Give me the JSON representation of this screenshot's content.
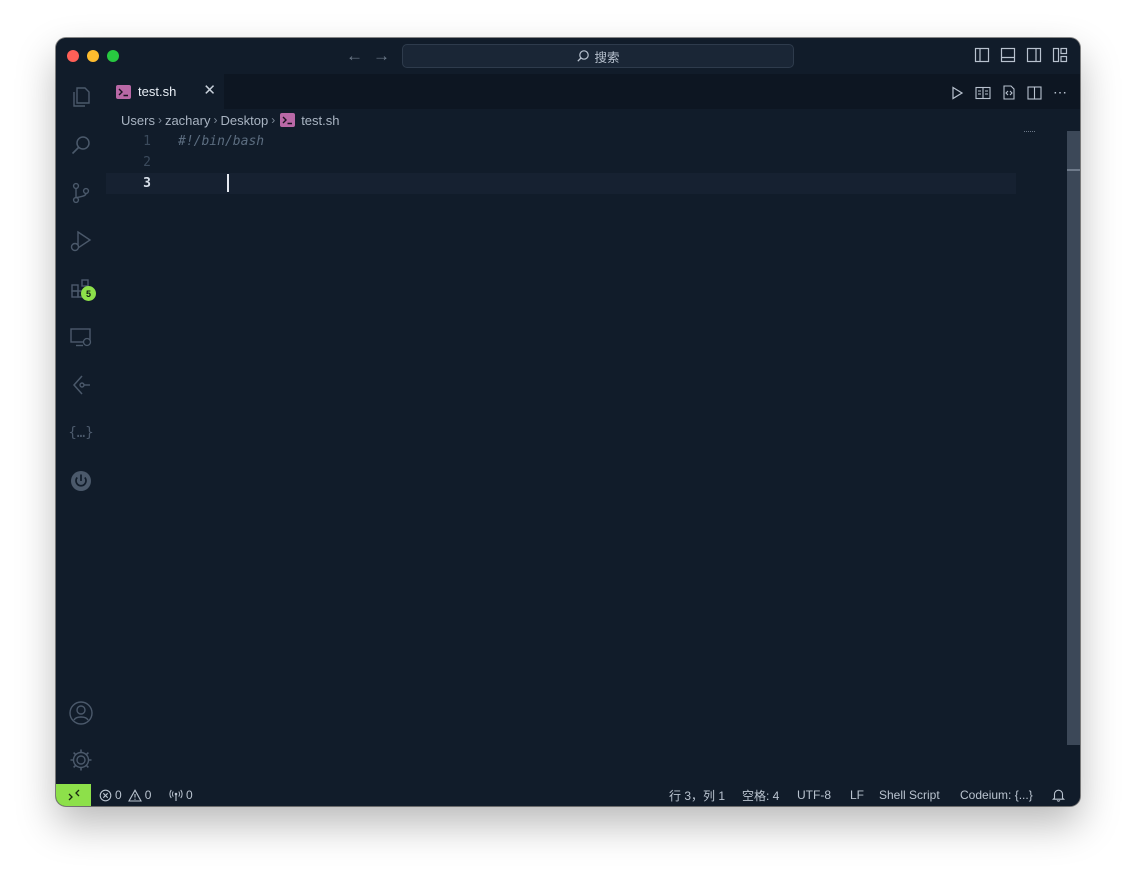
{
  "titlebar": {
    "search_placeholder": "搜索"
  },
  "activity_bar": {
    "extensions_badge": "5"
  },
  "tab": {
    "label": "test.sh"
  },
  "breadcrumb": [
    "Users",
    "zachary",
    "Desktop",
    "test.sh"
  ],
  "editor": {
    "line_numbers": [
      "1",
      "2",
      "3"
    ],
    "lines": [
      "#!/bin/bash",
      "",
      ""
    ],
    "current_line": 3
  },
  "status_bar": {
    "errors": "0",
    "warnings": "0",
    "ports": "0",
    "position": "行 3，列 1",
    "indent": "空格: 4",
    "encoding": "UTF-8",
    "eol": "LF",
    "language": "Shell Script",
    "codeium": "Codeium: {...}"
  },
  "colors": {
    "background": "#111c2a",
    "accent_green": "#8de04a",
    "shell_icon": "#b968a6"
  }
}
